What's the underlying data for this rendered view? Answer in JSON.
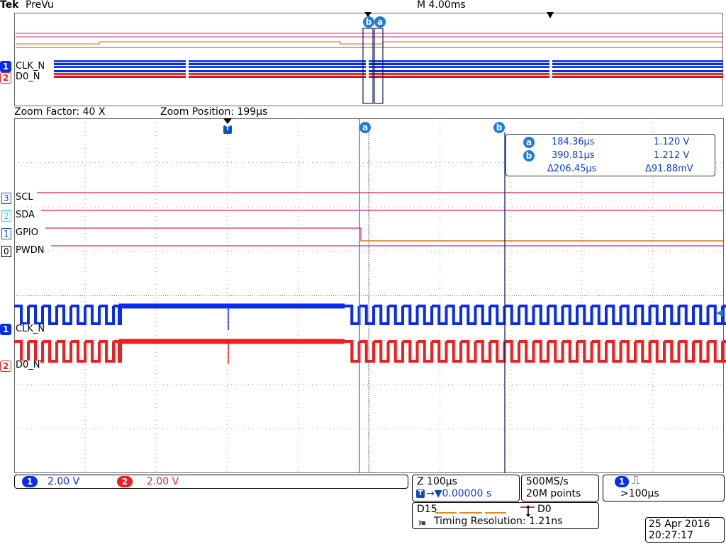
{
  "header": {
    "brand": "Tek",
    "mode": "PreVu",
    "timebase": "M 4.00ms"
  },
  "zoom": {
    "factor_label": "Zoom Factor: 40 X",
    "position_label": "Zoom Position: 199µs"
  },
  "overview": {
    "ch1_num": "1",
    "ch1_label": "CLK_N",
    "ch2_num": "2",
    "ch2_label": "D0_N",
    "cursor_a": "a",
    "cursor_b": "b"
  },
  "main": {
    "trigger_marker": "T",
    "cursor_a": "a",
    "cursor_b": "b",
    "digital": [
      {
        "num": "3",
        "label": "SCL"
      },
      {
        "num": "2",
        "label": "SDA"
      },
      {
        "num": "1",
        "label": "GPIO"
      },
      {
        "num": "0",
        "label": "PWDN"
      }
    ],
    "analog": [
      {
        "num": "1",
        "label": "CLK_N"
      },
      {
        "num": "2",
        "label": "D0_N"
      }
    ]
  },
  "cursor_readout": {
    "a_badge": "a",
    "a_time": "184.36µs",
    "a_volt": "1.120 V",
    "b_badge": "b",
    "b_time": "390.81µs",
    "b_volt": "1.212 V",
    "delta_time": "Δ206.45µs",
    "delta_volt": "Δ91.88mV"
  },
  "status": {
    "ch1_num": "1",
    "ch1_scale": "2.00 V",
    "ch2_num": "2",
    "ch2_scale": "2.00 V",
    "zoom_scale": "Z 100µs",
    "trigger_pos": "→▼0.00000 s",
    "trigger_pos_badge": "T",
    "sample_rate": "500MS/s",
    "record_length": "20M points",
    "trig_ch": "1",
    "trig_symbol": "⎍",
    "trig_condition": ">100µs",
    "digital_range_start": "D15",
    "digital_range_end": "D0",
    "timing_resolution": "Timing Resolution: 1.21ns",
    "date": "25 Apr  2016",
    "time": "20:27:17"
  },
  "colors": {
    "ch1": "#0a2cf0",
    "ch2": "#f01e1e",
    "digital_high": "#e0206a",
    "digital_low": "#e08a20",
    "cursor": "#1c7ce0",
    "grid": "#9a9a9a"
  }
}
